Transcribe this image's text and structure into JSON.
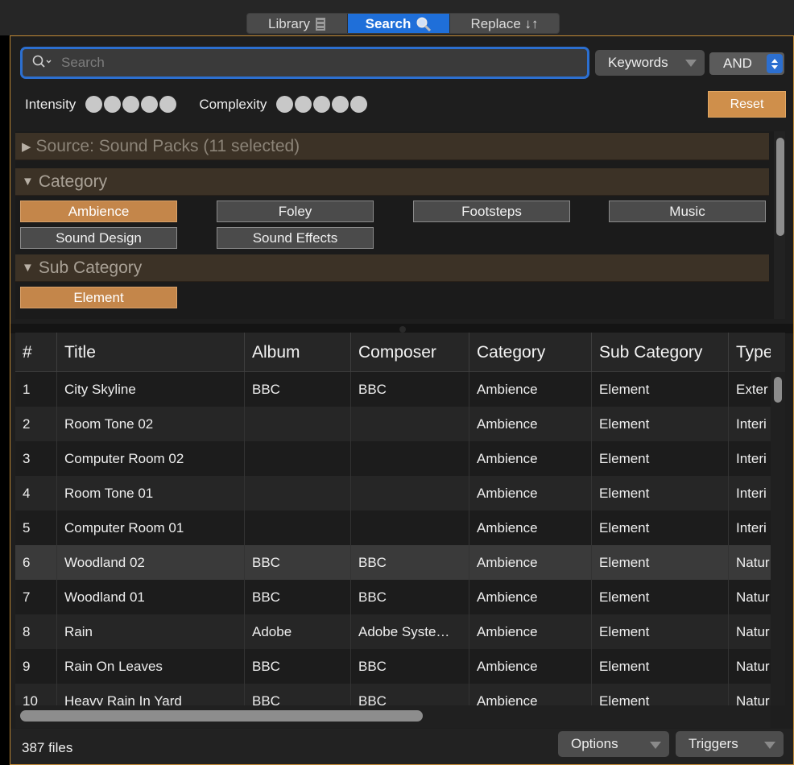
{
  "tabs": [
    {
      "label": "Library",
      "icon": "cabinet-icon"
    },
    {
      "label": "Search",
      "icon": "magnifier-icon"
    },
    {
      "label": "Replace ↓↑",
      "icon": ""
    }
  ],
  "search": {
    "placeholder": "Search",
    "value": ""
  },
  "keywords_label": "Keywords",
  "logic_select": "AND",
  "intensity_label": "Intensity",
  "complexity_label": "Complexity",
  "reset_label": "Reset",
  "source_header": "Source: Sound Packs (11 selected)",
  "category_header": "Category",
  "categories": [
    "Ambience",
    "Foley",
    "Footsteps",
    "Music",
    "Sound Design",
    "Sound Effects"
  ],
  "selected_category": "Ambience",
  "subcategory_header": "Sub Category",
  "subcategories": [
    "Element"
  ],
  "columns": [
    "#",
    "Title",
    "Album",
    "Composer",
    "Category",
    "Sub Category",
    "Type"
  ],
  "rows": [
    [
      "1",
      "City Skyline",
      "BBC",
      "BBC",
      "Ambience",
      "Element",
      "Exter"
    ],
    [
      "2",
      "Room Tone 02",
      "",
      "",
      "Ambience",
      "Element",
      "Interi"
    ],
    [
      "3",
      "Computer Room 02",
      "",
      "",
      "Ambience",
      "Element",
      "Interi"
    ],
    [
      "4",
      "Room Tone 01",
      "",
      "",
      "Ambience",
      "Element",
      "Interi"
    ],
    [
      "5",
      "Computer Room 01",
      "",
      "",
      "Ambience",
      "Element",
      "Interi"
    ],
    [
      "6",
      "Woodland 02",
      "BBC",
      "BBC",
      "Ambience",
      "Element",
      "Natur"
    ],
    [
      "7",
      "Woodland 01",
      "BBC",
      "BBC",
      "Ambience",
      "Element",
      "Natur"
    ],
    [
      "8",
      "Rain",
      "Adobe",
      "Adobe Syste…",
      "Ambience",
      "Element",
      "Natur"
    ],
    [
      "9",
      "Rain On Leaves",
      "BBC",
      "BBC",
      "Ambience",
      "Element",
      "Natur"
    ],
    [
      "10",
      "Heavy Rain In Yard",
      "BBC",
      "BBC",
      "Ambience",
      "Element",
      "Natur"
    ]
  ],
  "selected_row": 5,
  "file_count": "387 files",
  "options_label": "Options",
  "triggers_label": "Triggers",
  "colors": {
    "accent": "#c4864a",
    "selection_blue": "#1f6fd9",
    "frame": "#c18a36"
  }
}
